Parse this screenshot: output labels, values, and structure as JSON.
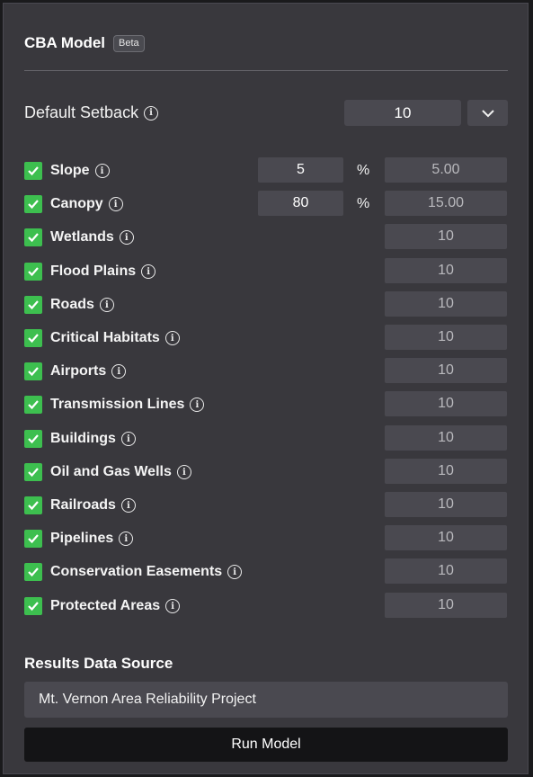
{
  "header": {
    "title": "CBA Model",
    "badge": "Beta"
  },
  "default_setback": {
    "label": "Default Setback",
    "info_icon": "info-circle-icon",
    "value": "10",
    "dropdown_icon": "chevron-down-icon"
  },
  "constraints": [
    {
      "label": "Slope",
      "checked": true,
      "percent": "5",
      "percent_sign": "%",
      "value": "5.00"
    },
    {
      "label": "Canopy",
      "checked": true,
      "percent": "80",
      "percent_sign": "%",
      "value": "15.00"
    },
    {
      "label": "Wetlands",
      "checked": true,
      "value": "10"
    },
    {
      "label": "Flood Plains",
      "checked": true,
      "value": "10"
    },
    {
      "label": "Roads",
      "checked": true,
      "value": "10"
    },
    {
      "label": "Critical Habitats",
      "checked": true,
      "value": "10"
    },
    {
      "label": "Airports",
      "checked": true,
      "value": "10"
    },
    {
      "label": "Transmission Lines",
      "checked": true,
      "value": "10"
    },
    {
      "label": "Buildings",
      "checked": true,
      "value": "10"
    },
    {
      "label": "Oil and Gas Wells",
      "checked": true,
      "value": "10"
    },
    {
      "label": "Railroads",
      "checked": true,
      "value": "10"
    },
    {
      "label": "Pipelines",
      "checked": true,
      "value": "10"
    },
    {
      "label": "Conservation Easements",
      "checked": true,
      "value": "10"
    },
    {
      "label": "Protected Areas",
      "checked": true,
      "value": "10"
    }
  ],
  "results": {
    "title": "Results Data Source",
    "source_value": "Mt. Vernon Area Reliability Project"
  },
  "run_button": {
    "label": "Run Model"
  },
  "colors": {
    "panel": "#39383d",
    "input": "#4a4950",
    "checkbox": "#3dbf4f",
    "button": "#141416"
  }
}
